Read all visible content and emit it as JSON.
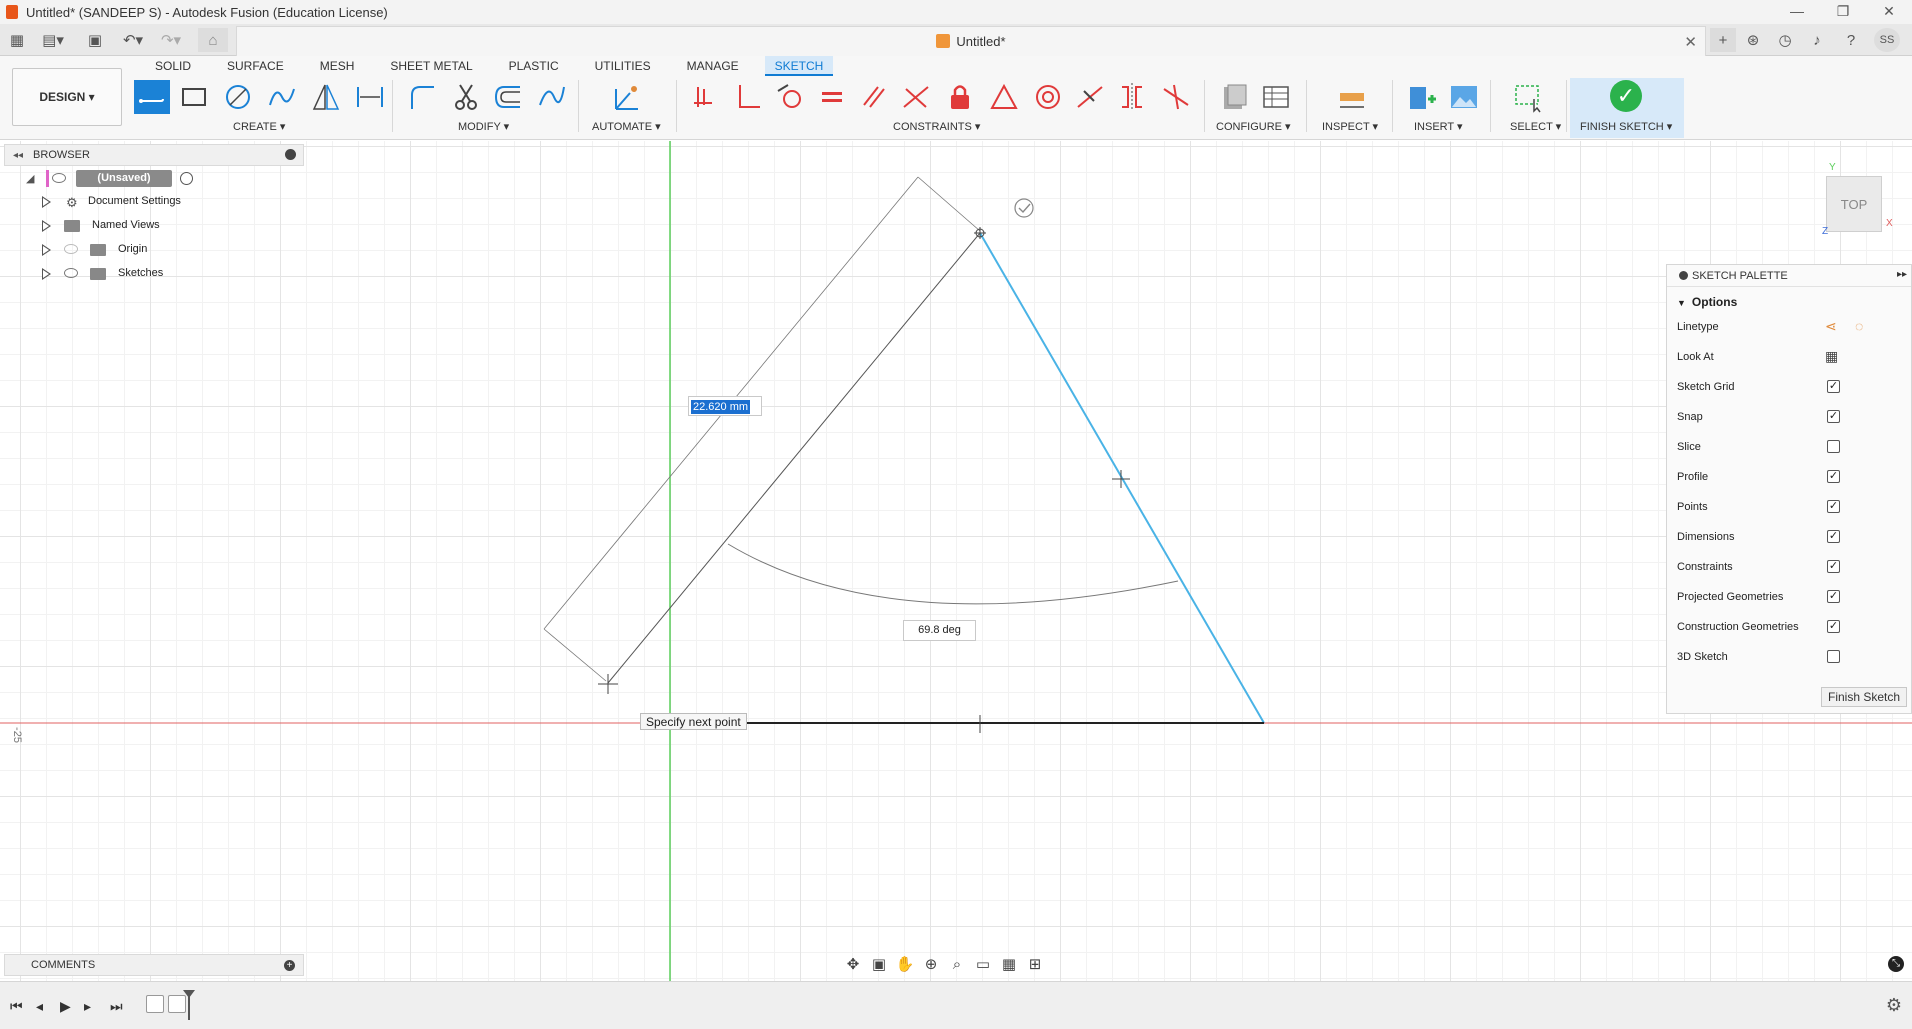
{
  "window": {
    "title": "Untitled* (SANDEEP S) - Autodesk Fusion (Education License)",
    "controls": [
      "—",
      "❐",
      "✕"
    ]
  },
  "quick_access": {
    "doc_tab_title": "Untitled*",
    "user_initials": "SS"
  },
  "ribbon": {
    "workspace": "DESIGN ▾",
    "tabs": [
      "SOLID",
      "SURFACE",
      "MESH",
      "SHEET METAL",
      "PLASTIC",
      "UTILITIES",
      "MANAGE",
      "SKETCH"
    ],
    "active_tab": "SKETCH",
    "groups": {
      "create": "CREATE ▾",
      "modify": "MODIFY ▾",
      "automate": "AUTOMATE ▾",
      "constraints": "CONSTRAINTS ▾",
      "configure": "CONFIGURE ▾",
      "inspect": "INSPECT ▾",
      "insert": "INSERT ▾",
      "select": "SELECT ▾",
      "finish_sketch": "FINISH SKETCH ▾"
    },
    "colors": {
      "accent": "#0f7bd3",
      "finish_green": "#2bb24c",
      "constraint_red": "#e03a3a"
    }
  },
  "browser": {
    "title": "BROWSER",
    "root": "(Unsaved)",
    "items": [
      {
        "label": "Document Settings",
        "icon": "gear-icon"
      },
      {
        "label": "Named Views",
        "icon": "folder-icon"
      },
      {
        "label": "Origin",
        "icon": "folder-icon",
        "hidden": true
      },
      {
        "label": "Sketches",
        "icon": "folder-icon"
      }
    ]
  },
  "canvas": {
    "dimension_value": "22.620 mm",
    "angle_value": "69.8 deg",
    "tooltip": "Specify next point",
    "axis_label": "-25",
    "line_color": "#4ab3e6",
    "x_axis_color": "#e06060",
    "y_axis_color": "#5ccf5c"
  },
  "viewcube": {
    "face": "TOP",
    "axis_y": "Y",
    "axis_x": "X",
    "axis_z": "Z"
  },
  "palette": {
    "title": "SKETCH PALETTE",
    "section": "Options",
    "rows": [
      {
        "label": "Linetype",
        "type": "icons"
      },
      {
        "label": "Look At",
        "type": "icon"
      },
      {
        "label": "Sketch Grid",
        "checked": "✓"
      },
      {
        "label": "Snap",
        "checked": "✓"
      },
      {
        "label": "Slice",
        "checked": ""
      },
      {
        "label": "Profile",
        "checked": "✓"
      },
      {
        "label": "Points",
        "checked": "✓"
      },
      {
        "label": "Dimensions",
        "checked": "✓"
      },
      {
        "label": "Constraints",
        "checked": "✓"
      },
      {
        "label": "Projected Geometries",
        "checked": "✓"
      },
      {
        "label": "Construction Geometries",
        "checked": "✓"
      },
      {
        "label": "3D Sketch",
        "checked": ""
      }
    ],
    "finish_button": "Finish Sketch"
  },
  "comments": {
    "title": "COMMENTS"
  }
}
